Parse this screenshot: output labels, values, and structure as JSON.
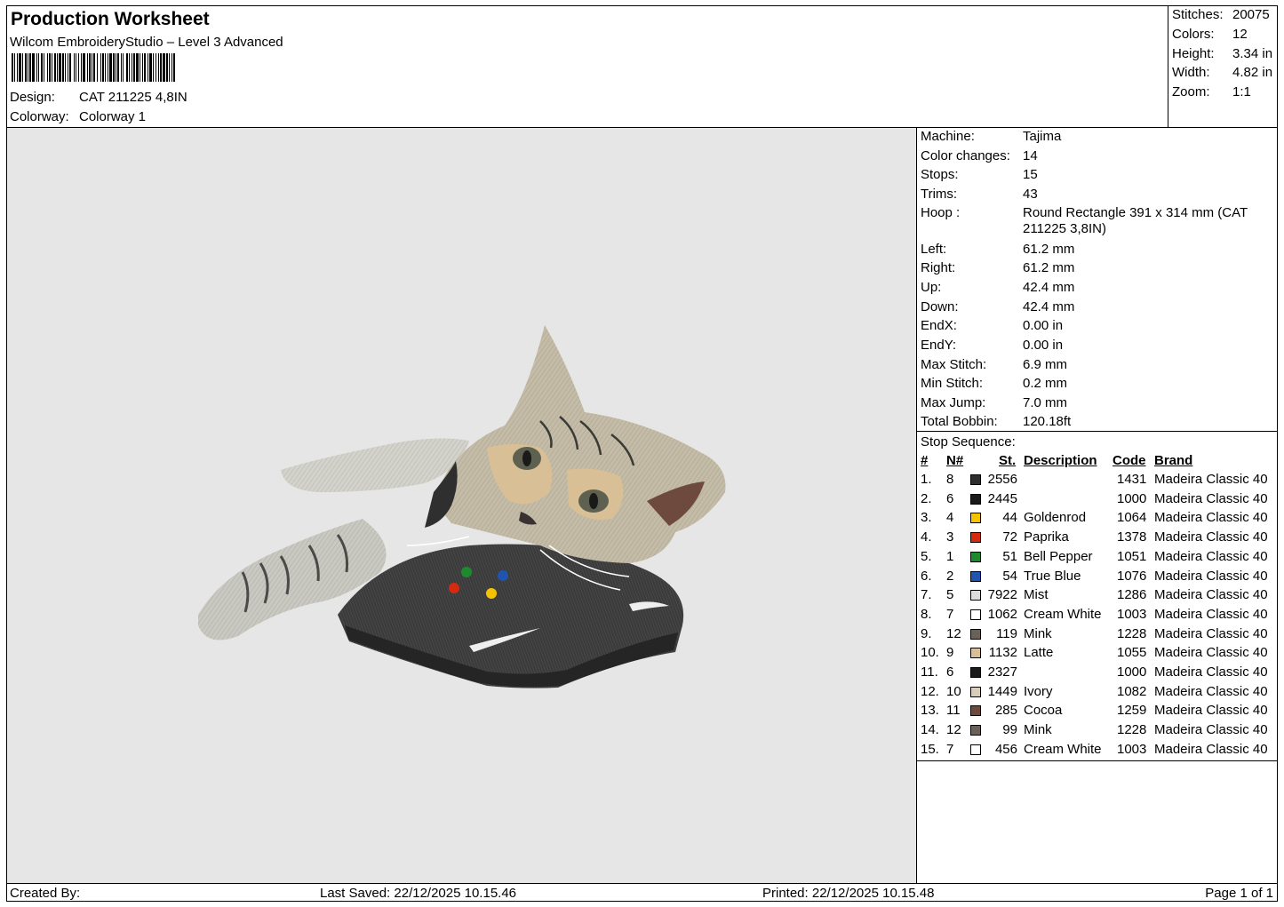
{
  "header": {
    "title": "Production Worksheet",
    "subtitle": "Wilcom EmbroideryStudio – Level 3 Advanced",
    "design_label": "Design:",
    "design_value": "CAT 211225 4,8IN",
    "colorway_label": "Colorway:",
    "colorway_value": "Colorway 1"
  },
  "stats": [
    {
      "label": "Stitches:",
      "value": "20075"
    },
    {
      "label": "Colors:",
      "value": "12"
    },
    {
      "label": "Height:",
      "value": "3.34 in"
    },
    {
      "label": "Width:",
      "value": "4.82 in"
    },
    {
      "label": "Zoom:",
      "value": "1:1"
    }
  ],
  "machine_info": [
    {
      "label": "Machine:",
      "value": "Tajima"
    },
    {
      "label": "Color changes:",
      "value": "14"
    },
    {
      "label": "Stops:",
      "value": "15"
    },
    {
      "label": "Trims:",
      "value": "43"
    },
    {
      "label": "Hoop :",
      "value": "Round Rectangle 391 x 314 mm (CAT 211225 3,8IN)"
    },
    {
      "label": "Left:",
      "value": "61.2 mm"
    },
    {
      "label": "Right:",
      "value": "61.2 mm"
    },
    {
      "label": "Up:",
      "value": "42.4 mm"
    },
    {
      "label": "Down:",
      "value": "42.4 mm"
    },
    {
      "label": "EndX:",
      "value": "0.00 in"
    },
    {
      "label": "EndY:",
      "value": "0.00 in"
    },
    {
      "label": "Max Stitch:",
      "value": "6.9 mm"
    },
    {
      "label": "Min Stitch:",
      "value": "0.2 mm"
    },
    {
      "label": "Max Jump:",
      "value": "7.0 mm"
    },
    {
      "label": "Total Bobbin:",
      "value": "120.18ft"
    }
  ],
  "stop_sequence": {
    "title": "Stop Sequence:",
    "headers": {
      "idx": "#",
      "num": "N#",
      "st": "St.",
      "desc": "Description",
      "code": "Code",
      "brand": "Brand"
    },
    "rows": [
      {
        "idx": "1.",
        "num": "8",
        "st": "2556",
        "desc": "",
        "code": "1431",
        "brand": "Madeira Classic 40",
        "color": "#2f2f2f"
      },
      {
        "idx": "2.",
        "num": "6",
        "st": "2445",
        "desc": "",
        "code": "1000",
        "brand": "Madeira Classic 40",
        "color": "#1a1a1a"
      },
      {
        "idx": "3.",
        "num": "4",
        "st": "44",
        "desc": "Goldenrod",
        "code": "1064",
        "brand": "Madeira Classic 40",
        "color": "#f5c400"
      },
      {
        "idx": "4.",
        "num": "3",
        "st": "72",
        "desc": "Paprika",
        "code": "1378",
        "brand": "Madeira Classic 40",
        "color": "#d42a10"
      },
      {
        "idx": "5.",
        "num": "1",
        "st": "51",
        "desc": "Bell Pepper",
        "code": "1051",
        "brand": "Madeira Classic 40",
        "color": "#1e8a2e"
      },
      {
        "idx": "6.",
        "num": "2",
        "st": "54",
        "desc": "True Blue",
        "code": "1076",
        "brand": "Madeira Classic 40",
        "color": "#1f55b0"
      },
      {
        "idx": "7.",
        "num": "5",
        "st": "7922",
        "desc": "Mist",
        "code": "1286",
        "brand": "Madeira Classic 40",
        "color": "#dcdcdc"
      },
      {
        "idx": "8.",
        "num": "7",
        "st": "1062",
        "desc": "Cream White",
        "code": "1003",
        "brand": "Madeira Classic 40",
        "color": "#ffffff"
      },
      {
        "idx": "9.",
        "num": "12",
        "st": "119",
        "desc": "Mink",
        "code": "1228",
        "brand": "Madeira Classic 40",
        "color": "#6a6258"
      },
      {
        "idx": "10.",
        "num": "9",
        "st": "1132",
        "desc": "Latte",
        "code": "1055",
        "brand": "Madeira Classic 40",
        "color": "#d9bf96"
      },
      {
        "idx": "11.",
        "num": "6",
        "st": "2327",
        "desc": "",
        "code": "1000",
        "brand": "Madeira Classic 40",
        "color": "#1a1a1a"
      },
      {
        "idx": "12.",
        "num": "10",
        "st": "1449",
        "desc": "Ivory",
        "code": "1082",
        "brand": "Madeira Classic 40",
        "color": "#d8cdb8"
      },
      {
        "idx": "13.",
        "num": "11",
        "st": "285",
        "desc": "Cocoa",
        "code": "1259",
        "brand": "Madeira Classic 40",
        "color": "#6e4a3e"
      },
      {
        "idx": "14.",
        "num": "12",
        "st": "99",
        "desc": "Mink",
        "code": "1228",
        "brand": "Madeira Classic 40",
        "color": "#6a6258"
      },
      {
        "idx": "15.",
        "num": "7",
        "st": "456",
        "desc": "Cream White",
        "code": "1003",
        "brand": "Madeira Classic 40",
        "color": "#ffffff"
      }
    ]
  },
  "footer": {
    "created_by": "Created By:",
    "last_saved": "Last Saved: 22/12/2025 10.15.46",
    "printed": "Printed: 22/12/2025 10.15.48",
    "page": "Page 1 of 1"
  }
}
